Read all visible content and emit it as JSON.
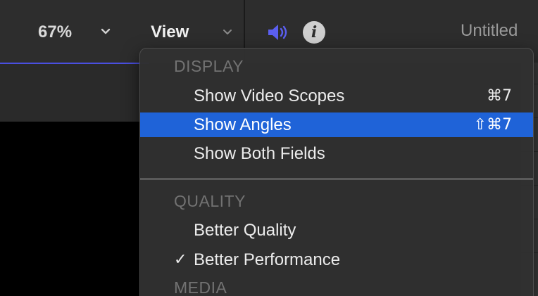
{
  "toolbar": {
    "zoom_value": "67%",
    "zoom_chevron_icon": "chevron-down-icon",
    "view_menu_label": "View",
    "view_chevron_icon": "chevron-down-icon",
    "speaker_icon": "speaker-icon",
    "info_icon": "info-icon",
    "info_glyph": "i",
    "project_title": "Untitled"
  },
  "view_menu": {
    "sections": [
      {
        "header": "DISPLAY",
        "items": [
          {
            "label": "Show Video Scopes",
            "shortcut": "⌘7",
            "checked": false,
            "selected": false
          },
          {
            "label": "Show Angles",
            "shortcut": "⇧⌘7",
            "checked": false,
            "selected": true
          },
          {
            "label": "Show Both Fields",
            "shortcut": "",
            "checked": false,
            "selected": false
          }
        ]
      },
      {
        "header": "QUALITY",
        "items": [
          {
            "label": "Better Quality",
            "shortcut": "",
            "checked": false,
            "selected": false
          },
          {
            "label": "Better Performance",
            "shortcut": "",
            "checked": true,
            "selected": false
          }
        ]
      },
      {
        "header": "MEDIA",
        "items": []
      }
    ],
    "checkmark_glyph": "✓"
  },
  "colors": {
    "selection_highlight": "#1f63d8",
    "speaker_accent": "#5b5ff0",
    "timeline_accent": "#4a4fe0",
    "menu_background": "#303030",
    "section_header_text": "#727272"
  }
}
